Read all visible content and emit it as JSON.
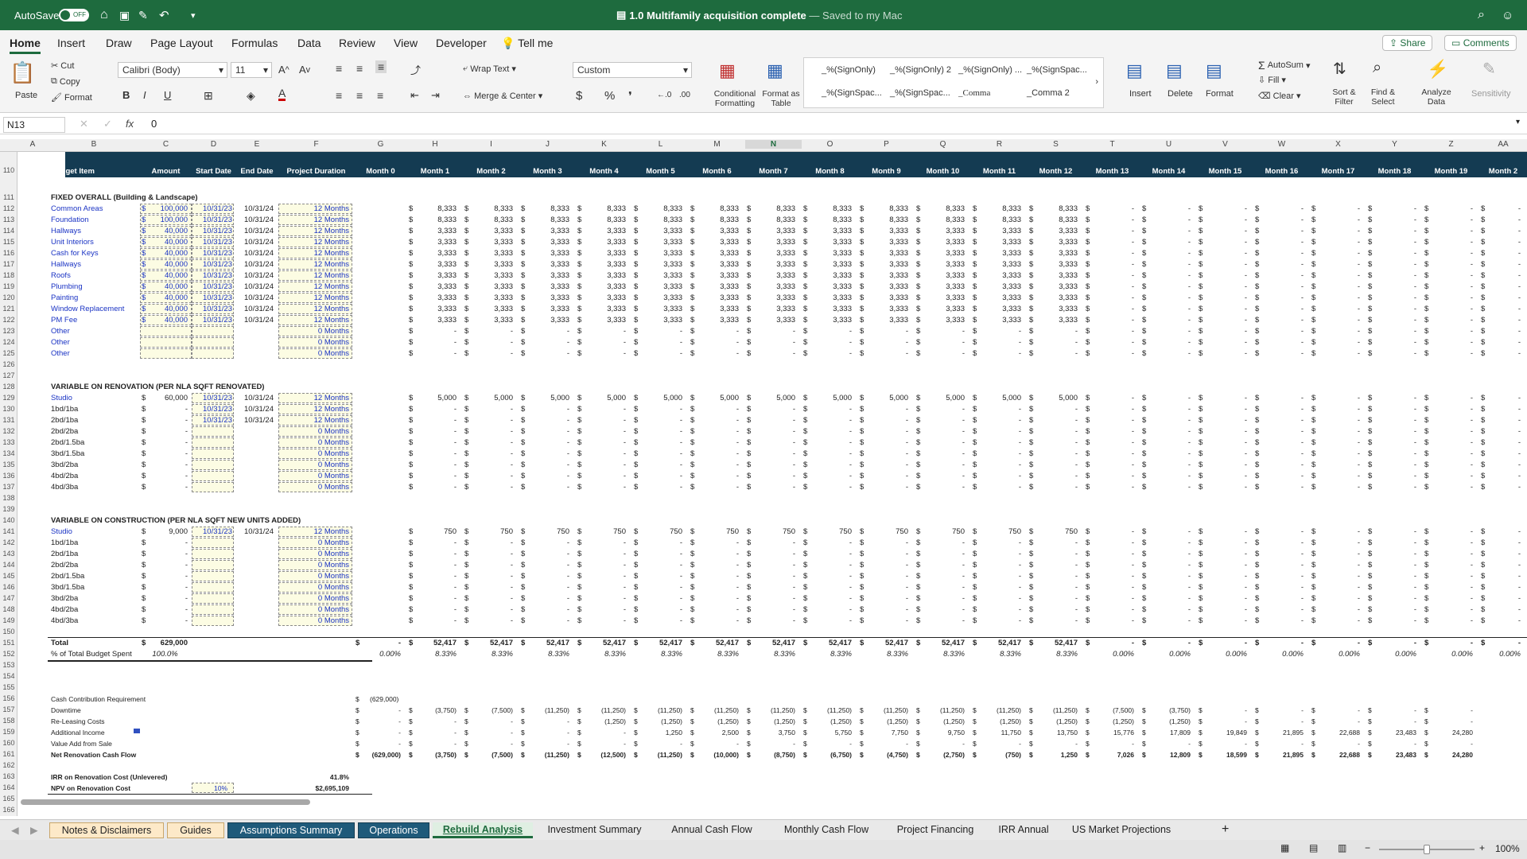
{
  "app": {
    "autosave": "AutoSave",
    "autosave_state": "OFF",
    "title": "1.0 Multifamily acquisition complete",
    "saved": "— Saved to my Mac"
  },
  "ribbon_tabs": [
    "Home",
    "Insert",
    "Draw",
    "Page Layout",
    "Formulas",
    "Data",
    "Review",
    "View",
    "Developer",
    "Tell me"
  ],
  "share": "Share",
  "comments": "Comments",
  "ribbon": {
    "paste": "Paste",
    "cut": "Cut",
    "copy": "Copy",
    "format": "Format",
    "font": "Calibri (Body)",
    "size": "11",
    "wrap": "Wrap Text",
    "merge": "Merge & Center",
    "numfmt": "Custom",
    "cond": "Conditional Formatting",
    "fmt_table": "Format as Table",
    "styles": [
      "_%(SignOnly)",
      "_%(SignOnly) 2",
      "_%(SignOnly) ...",
      "_%(SignSpac...",
      "_%(SignSpac...",
      "_%(SignSpac...",
      "_Comma",
      "_Comma 2"
    ],
    "insert": "Insert",
    "delete": "Delete",
    "format2": "Format",
    "autosum": "AutoSum",
    "fill": "Fill",
    "clear": "Clear",
    "sort": "Sort & Filter",
    "find": "Find & Select",
    "analyze": "Analyze Data",
    "sensitivity": "Sensitivity"
  },
  "namebox": "N13",
  "formula": "0",
  "fx": "fx",
  "columns": [
    "A",
    "B",
    "C",
    "D",
    "E",
    "F",
    "G",
    "H",
    "I",
    "J",
    "K",
    "L",
    "M",
    "N",
    "O",
    "P",
    "Q",
    "R",
    "S",
    "T",
    "U",
    "V",
    "W",
    "X",
    "Y",
    "Z",
    "AA"
  ],
  "header_row": {
    "num": "110",
    "budget": "Budget Item",
    "amount": "Amount",
    "start": "Start Date",
    "end": "End Date",
    "duration": "Project Duration",
    "months": [
      "Month 0",
      "Month 1",
      "Month 2",
      "Month 3",
      "Month 4",
      "Month 5",
      "Month 6",
      "Month 7",
      "Month 8",
      "Month 9",
      "Month 10",
      "Month 11",
      "Month 12",
      "Month 13",
      "Month 14",
      "Month 15",
      "Month 16",
      "Month 17",
      "Month 18",
      "Month 19",
      "Month 2"
    ]
  },
  "sections": [
    {
      "row": "111",
      "title": "FIXED OVERALL (Building & Landscape)"
    },
    {
      "row": "128",
      "title": "VARIABLE ON RENOVATION (PER NLA SQFT RENOVATED)"
    },
    {
      "row": "140",
      "title": "VARIABLE ON CONSTRUCTION (PER NLA SQFT NEW UNITS ADDED)"
    }
  ],
  "fixed_rows": [
    {
      "n": "112",
      "item": "Common Areas",
      "amt": "100,000",
      "start": "10/31/23",
      "end": "10/31/24",
      "dur": "12 Months",
      "m": "8,333"
    },
    {
      "n": "113",
      "item": "Foundation",
      "amt": "100,000",
      "start": "10/31/23",
      "end": "10/31/24",
      "dur": "12 Months",
      "m": "8,333"
    },
    {
      "n": "114",
      "item": "Hallways",
      "amt": "40,000",
      "start": "10/31/23",
      "end": "10/31/24",
      "dur": "12 Months",
      "m": "3,333"
    },
    {
      "n": "115",
      "item": "Unit Interiors",
      "amt": "40,000",
      "start": "10/31/23",
      "end": "10/31/24",
      "dur": "12 Months",
      "m": "3,333"
    },
    {
      "n": "116",
      "item": "Cash for Keys",
      "amt": "40,000",
      "start": "10/31/23",
      "end": "10/31/24",
      "dur": "12 Months",
      "m": "3,333"
    },
    {
      "n": "117",
      "item": "Hallways",
      "amt": "40,000",
      "start": "10/31/23",
      "end": "10/31/24",
      "dur": "12 Months",
      "m": "3,333"
    },
    {
      "n": "118",
      "item": "Roofs",
      "amt": "40,000",
      "start": "10/31/23",
      "end": "10/31/24",
      "dur": "12 Months",
      "m": "3,333"
    },
    {
      "n": "119",
      "item": "Plumbing",
      "amt": "40,000",
      "start": "10/31/23",
      "end": "10/31/24",
      "dur": "12 Months",
      "m": "3,333"
    },
    {
      "n": "120",
      "item": "Painting",
      "amt": "40,000",
      "start": "10/31/23",
      "end": "10/31/24",
      "dur": "12 Months",
      "m": "3,333"
    },
    {
      "n": "121",
      "item": "Window Replacement",
      "amt": "40,000",
      "start": "10/31/23",
      "end": "10/31/24",
      "dur": "12 Months",
      "m": "3,333"
    },
    {
      "n": "122",
      "item": "PM Fee",
      "amt": "40,000",
      "start": "10/31/23",
      "end": "10/31/24",
      "dur": "12 Months",
      "m": "3,333"
    },
    {
      "n": "123",
      "item": "Other",
      "amt": "",
      "start": "",
      "end": "",
      "dur": "0 Months",
      "m": "-"
    },
    {
      "n": "124",
      "item": "Other",
      "amt": "",
      "start": "",
      "end": "",
      "dur": "0 Months",
      "m": "-"
    },
    {
      "n": "125",
      "item": "Other",
      "amt": "",
      "start": "",
      "end": "",
      "dur": "0 Months",
      "m": "-"
    }
  ],
  "reno_rows": [
    {
      "n": "129",
      "item": "Studio",
      "amt": "60,000",
      "start": "10/31/23",
      "end": "10/31/24",
      "dur": "12 Months",
      "m": "5,000"
    },
    {
      "n": "130",
      "item": "1bd/1ba",
      "amt": "-",
      "start": "10/31/23",
      "end": "10/31/24",
      "dur": "12 Months",
      "m": "-"
    },
    {
      "n": "131",
      "item": "2bd/1ba",
      "amt": "-",
      "start": "10/31/23",
      "end": "10/31/24",
      "dur": "12 Months",
      "m": "-"
    },
    {
      "n": "132",
      "item": "2bd/2ba",
      "amt": "-",
      "start": "",
      "end": "",
      "dur": "0 Months",
      "m": "-"
    },
    {
      "n": "133",
      "item": "2bd/1.5ba",
      "amt": "-",
      "start": "",
      "end": "",
      "dur": "0 Months",
      "m": "-"
    },
    {
      "n": "134",
      "item": "3bd/1.5ba",
      "amt": "-",
      "start": "",
      "end": "",
      "dur": "0 Months",
      "m": "-"
    },
    {
      "n": "135",
      "item": "3bd/2ba",
      "amt": "-",
      "start": "",
      "end": "",
      "dur": "0 Months",
      "m": "-"
    },
    {
      "n": "136",
      "item": "4bd/2ba",
      "amt": "-",
      "start": "",
      "end": "",
      "dur": "0 Months",
      "m": "-"
    },
    {
      "n": "137",
      "item": "4bd/3ba",
      "amt": "-",
      "start": "",
      "end": "",
      "dur": "0 Months",
      "m": "-"
    }
  ],
  "cons_rows": [
    {
      "n": "141",
      "item": "Studio",
      "amt": "9,000",
      "start": "10/31/23",
      "end": "10/31/24",
      "dur": "12 Months",
      "m": "750"
    },
    {
      "n": "142",
      "item": "1bd/1ba",
      "amt": "-",
      "start": "",
      "end": "",
      "dur": "0 Months",
      "m": "-"
    },
    {
      "n": "143",
      "item": "2bd/1ba",
      "amt": "-",
      "start": "",
      "end": "",
      "dur": "0 Months",
      "m": "-"
    },
    {
      "n": "144",
      "item": "2bd/2ba",
      "amt": "-",
      "start": "",
      "end": "",
      "dur": "0 Months",
      "m": "-"
    },
    {
      "n": "145",
      "item": "2bd/1.5ba",
      "amt": "-",
      "start": "",
      "end": "",
      "dur": "0 Months",
      "m": "-"
    },
    {
      "n": "146",
      "item": "3bd/1.5ba",
      "amt": "-",
      "start": "",
      "end": "",
      "dur": "0 Months",
      "m": "-"
    },
    {
      "n": "147",
      "item": "3bd/2ba",
      "amt": "-",
      "start": "",
      "end": "",
      "dur": "0 Months",
      "m": "-"
    },
    {
      "n": "148",
      "item": "4bd/2ba",
      "amt": "-",
      "start": "",
      "end": "",
      "dur": "0 Months",
      "m": "-"
    },
    {
      "n": "149",
      "item": "4bd/3ba",
      "amt": "-",
      "start": "",
      "end": "",
      "dur": "0 Months",
      "m": "-"
    }
  ],
  "total": {
    "n": "151",
    "label": "Total",
    "amt": "629,000",
    "m0": "-",
    "m": "52,417"
  },
  "pct": {
    "n": "152",
    "label": "% of Total Budget Spent",
    "amt": "100.0%",
    "m0": "0.00%",
    "m": "8.33%",
    "rest": "0.00%"
  },
  "cash": {
    "cc": {
      "n": "156",
      "label": "Cash Contribution Requirement",
      "g": "(629,000)"
    },
    "dt": {
      "n": "157",
      "label": "Downtime",
      "vals": [
        "-",
        "(3,750)",
        "(7,500)",
        "(11,250)",
        "(11,250)",
        "(11,250)",
        "(11,250)",
        "(11,250)",
        "(11,250)",
        "(11,250)",
        "(11,250)",
        "(11,250)",
        "(11,250)",
        "(7,500)",
        "(3,750)",
        "-",
        "-",
        "-",
        "-",
        "-"
      ]
    },
    "rl": {
      "n": "158",
      "label": "Re-Leasing Costs",
      "vals": [
        "-",
        "-",
        "-",
        "-",
        "(1,250)",
        "(1,250)",
        "(1,250)",
        "(1,250)",
        "(1,250)",
        "(1,250)",
        "(1,250)",
        "(1,250)",
        "(1,250)",
        "(1,250)",
        "(1,250)",
        "-",
        "-",
        "-",
        "-",
        "-"
      ]
    },
    "ai": {
      "n": "159",
      "label": "Additional Income",
      "vals": [
        "-",
        "-",
        "-",
        "-",
        "-",
        "1,250",
        "2,500",
        "3,750",
        "5,750",
        "7,750",
        "9,750",
        "11,750",
        "13,750",
        "15,776",
        "17,809",
        "19,849",
        "21,895",
        "22,688",
        "23,483",
        "24,280"
      ]
    },
    "va": {
      "n": "160",
      "label": "Value Add from Sale",
      "vals": [
        "-",
        "-",
        "-",
        "-",
        "-",
        "-",
        "-",
        "-",
        "-",
        "-",
        "-",
        "-",
        "-",
        "-",
        "-",
        "-",
        "-",
        "-",
        "-",
        "-"
      ]
    },
    "net": {
      "n": "161",
      "label": "Net Renovation Cash Flow",
      "vals": [
        "(629,000)",
        "(3,750)",
        "(7,500)",
        "(11,250)",
        "(12,500)",
        "(11,250)",
        "(10,000)",
        "(8,750)",
        "(6,750)",
        "(4,750)",
        "(2,750)",
        "(750)",
        "1,250",
        "7,026",
        "12,809",
        "18,599",
        "21,895",
        "22,688",
        "23,483",
        "24,280"
      ]
    }
  },
  "irr": {
    "n": "163",
    "label": "IRR on Renovation Cost (Unlevered)",
    "val": "41.8%"
  },
  "npv": {
    "n": "164",
    "label": "NPV on Renovation Cost",
    "rate": "10%",
    "val": "$2,695,109"
  },
  "sheet_tabs": [
    "Notes & Disclaimers",
    "Guides",
    "Assumptions Summary",
    "Operations",
    "Rebuild Analysis",
    "Investment Summary",
    "Annual Cash Flow",
    "Monthly Cash Flow",
    "Project Financing",
    "IRR Annual",
    "US Market Projections"
  ],
  "zoom": "100%",
  "colors": {
    "titlebar": "#1e6b3e",
    "header_band": "#143b52",
    "input_blue": "#1a33c4"
  }
}
